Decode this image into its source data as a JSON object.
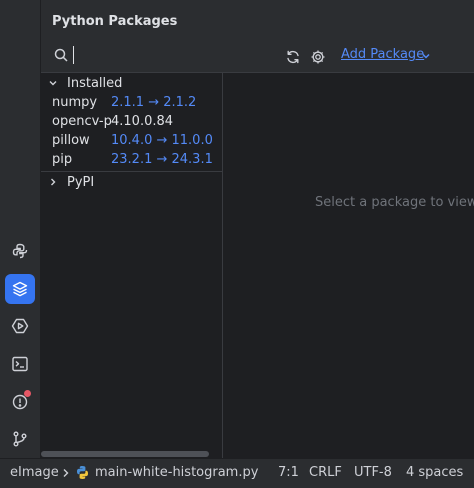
{
  "panel": {
    "title": "Python Packages",
    "add_package_label": "Add Package",
    "search_value": ""
  },
  "sections": {
    "installed": "Installed",
    "pypi": "PyPI"
  },
  "packages": [
    {
      "name": "numpy",
      "version": "2.1.1 → 2.1.2"
    },
    {
      "name": "opencv-python",
      "version": "4.10.0.84"
    },
    {
      "name": "pillow",
      "version": "10.4.0 → 11.0.0"
    },
    {
      "name": "pip",
      "version": "23.2.1 → 24.3.1"
    }
  ],
  "detail": {
    "empty_text": "Select a package to view documentation"
  },
  "status_bar": {
    "project": "eImage",
    "file": "main-white-histogram.py",
    "position": "7:1",
    "line_ending": "CRLF",
    "encoding": "UTF-8",
    "indent": "4 spaces"
  },
  "tool_window_icons": [
    "python-console-icon",
    "python-packages-icon",
    "services-icon",
    "terminal-icon",
    "problems-icon",
    "git-icon"
  ],
  "colors": {
    "accent": "#3574f0",
    "link": "#548af7",
    "notification": "#e55765"
  }
}
